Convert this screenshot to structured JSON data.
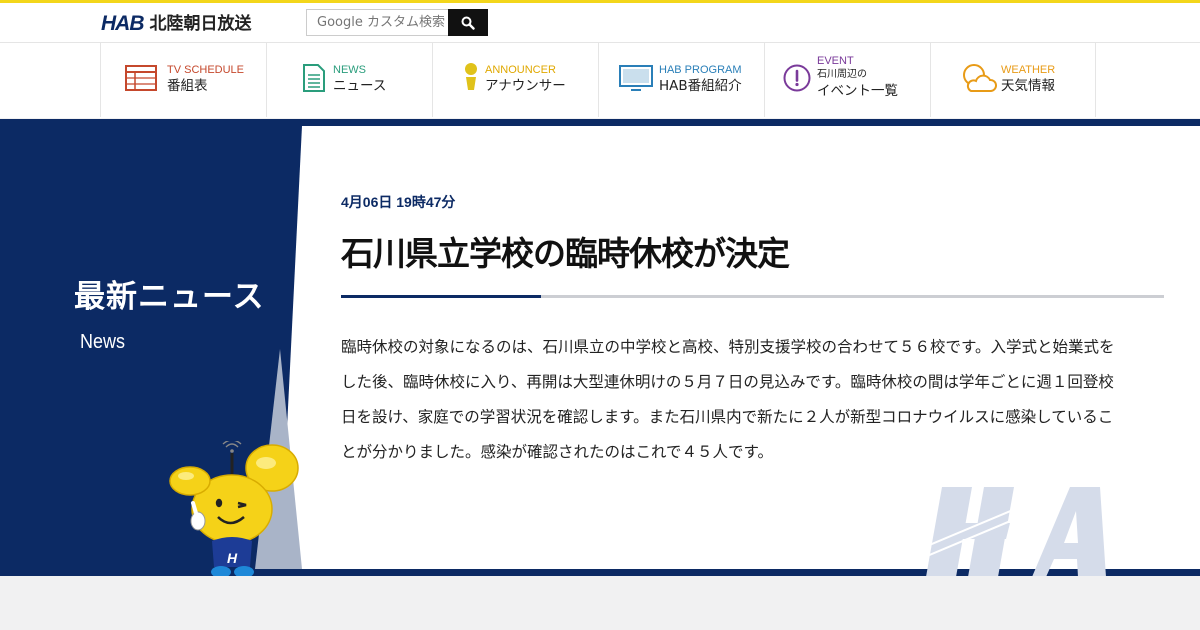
{
  "header": {
    "logo_mark": "HAB",
    "logo_name": "北陸朝日放送",
    "search": {
      "placeholder": "Google カスタム検索"
    }
  },
  "nav": {
    "items": [
      {
        "en": "TV SCHEDULE",
        "jp": "番組表",
        "icon": "tv-schedule-icon",
        "color": "#c5482c"
      },
      {
        "en": "NEWS",
        "jp": "ニュース",
        "icon": "news-icon",
        "color": "#2a9d7c"
      },
      {
        "en": "ANNOUNCER",
        "jp": "アナウンサー",
        "icon": "announcer-icon",
        "color": "#e0a800"
      },
      {
        "en": "HAB PROGRAM",
        "jp": "HAB番組紹介",
        "icon": "tv-monitor-icon",
        "color": "#2a7fb8"
      },
      {
        "en": "EVENT",
        "sub": "石川周辺の",
        "jp": "イベント一覧",
        "icon": "exclamation-icon",
        "color": "#7a3a9a"
      },
      {
        "en": "WEATHER",
        "jp": "天気情報",
        "icon": "weather-icon",
        "color": "#e89b17"
      }
    ]
  },
  "sidebar": {
    "title": "最新ニュース",
    "subtitle": "News"
  },
  "article": {
    "date": "4月06日 19時47分",
    "title": "石川県立学校の臨時休校が決定",
    "body": "臨時休校の対象になるのは、石川県立の中学校と高校、特別支援学校の合わせて５６校です。入学式と始業式をした後、臨時休校に入り、再開は大型連休明けの５月７日の見込みです。臨時休校の間は学年ごとに週１回登校日を設け、家庭での学習状況を確認します。また石川県内で新たに２人が新型コロナウイルスに感染していることが分かりました。感染が確認されたのはこれで４５人です。"
  },
  "colors": {
    "brand_navy": "#0c2a64",
    "accent_yellow": "#f3d61b"
  }
}
